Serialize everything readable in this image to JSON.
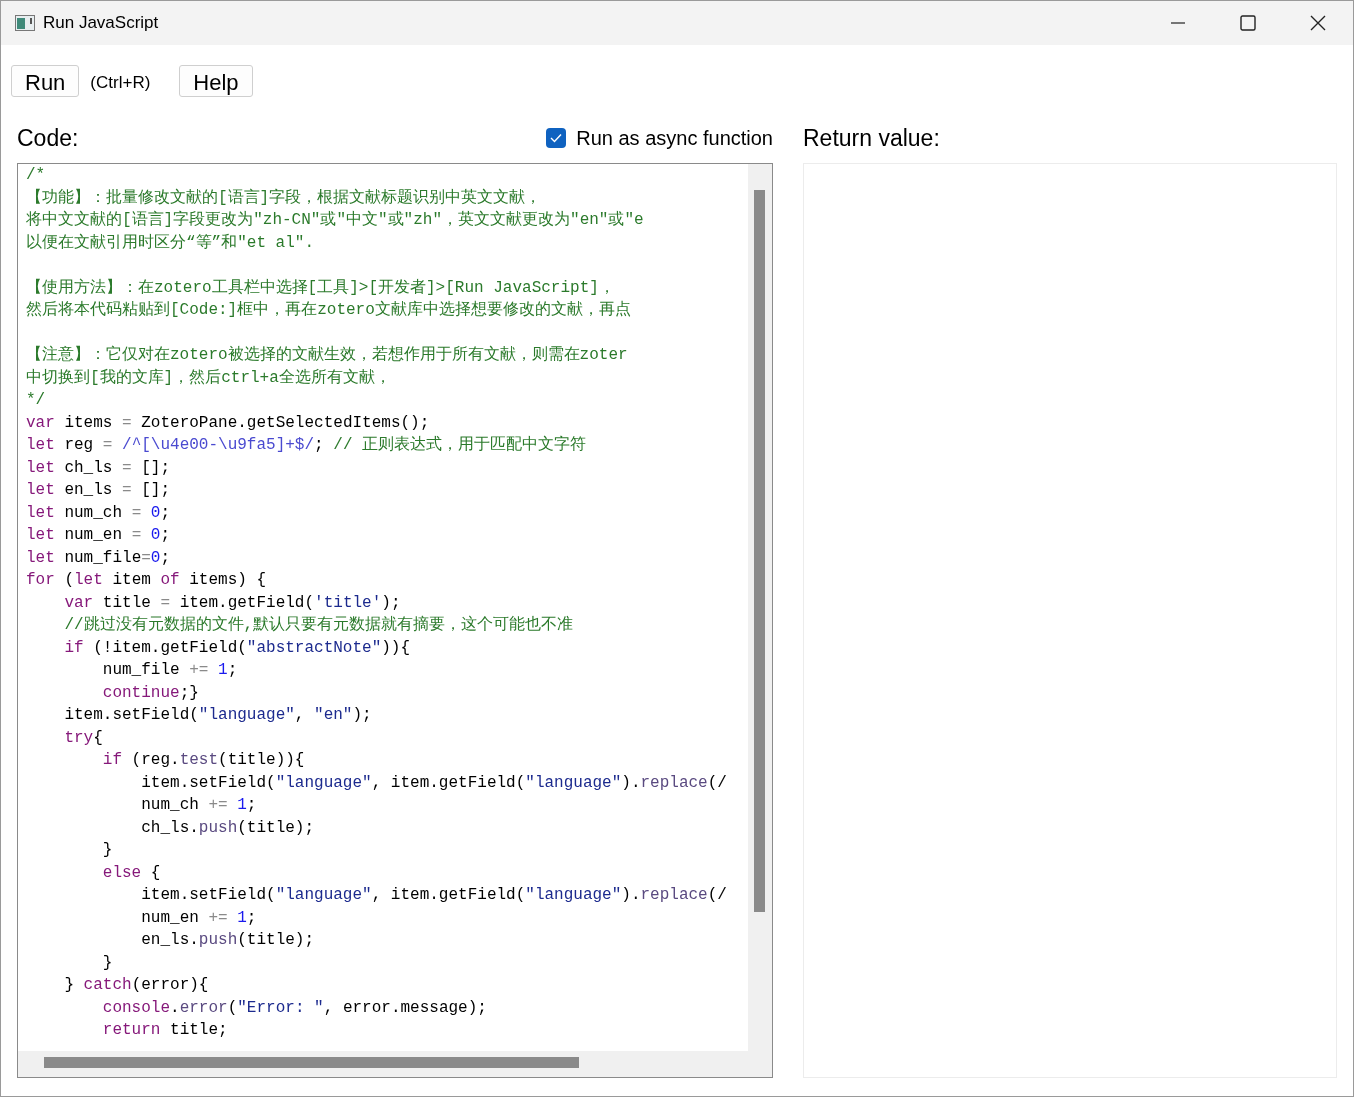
{
  "window": {
    "title": "Run JavaScript"
  },
  "toolbar": {
    "run_button": "Run",
    "shortcut": "(Ctrl+R)",
    "help_button": "Help"
  },
  "code_panel": {
    "label": "Code:",
    "async_option": {
      "label": "Run as async function",
      "checked": true
    },
    "lines": [
      {
        "tokens": [
          {
            "kind": "cmt",
            "text": "/*"
          }
        ]
      },
      {
        "tokens": [
          {
            "kind": "cmt",
            "text": "【功能】：批量修改文献的[语言]字段，根据文献标题识别中英文文献，"
          }
        ]
      },
      {
        "tokens": [
          {
            "kind": "cmt",
            "text": "将中文文献的[语言]字段更改为\"zh-CN\"或\"中文\"或\"zh\"，英文文献更改为\"en\"或\"e"
          }
        ]
      },
      {
        "tokens": [
          {
            "kind": "cmt",
            "text": "以便在文献引用时区分“等”和\"et al\"."
          }
        ]
      },
      {
        "kind": "blank"
      },
      {
        "tokens": [
          {
            "kind": "cmt",
            "text": "【使用方法】：在zotero工具栏中选择[工具]>[开发者]>[Run JavaScript]，"
          }
        ]
      },
      {
        "tokens": [
          {
            "kind": "cmt",
            "text": "然后将本代码粘贴到[Code:]框中，再在zotero文献库中选择想要修改的文献，再点"
          }
        ]
      },
      {
        "kind": "blank"
      },
      {
        "tokens": [
          {
            "kind": "cmt",
            "text": "【注意】：它仅对在zotero被选择的文献生效，若想作用于所有文献，则需在zoter"
          }
        ]
      },
      {
        "tokens": [
          {
            "kind": "cmt",
            "text": "中切换到[我的文库]，然后ctrl+a全选所有文献，"
          }
        ]
      },
      {
        "tokens": [
          {
            "kind": "cmt",
            "text": "*/"
          }
        ]
      },
      {
        "tokens": [
          {
            "kind": "kw",
            "text": "var"
          },
          {
            "kind": "tx",
            "text": " items "
          },
          {
            "kind": "op",
            "text": "="
          },
          {
            "kind": "tx",
            "text": " ZoteroPane.getSelectedItems();"
          }
        ]
      },
      {
        "tokens": [
          {
            "kind": "kw",
            "text": "let"
          },
          {
            "kind": "tx",
            "text": " reg "
          },
          {
            "kind": "op",
            "text": "="
          },
          {
            "kind": "re",
            "text": " /^[\\u4e00-\\u9fa5]+$/"
          },
          {
            "kind": "tx",
            "text": ";"
          },
          {
            "kind": "cmt",
            "text": " // 正则表达式，用于匹配中文字符"
          }
        ]
      },
      {
        "tokens": [
          {
            "kind": "kw",
            "text": "let"
          },
          {
            "kind": "tx",
            "text": " ch_ls "
          },
          {
            "kind": "op",
            "text": "="
          },
          {
            "kind": "tx",
            "text": " [];"
          }
        ]
      },
      {
        "tokens": [
          {
            "kind": "kw",
            "text": "let"
          },
          {
            "kind": "tx",
            "text": " en_ls "
          },
          {
            "kind": "op",
            "text": "="
          },
          {
            "kind": "tx",
            "text": " [];"
          }
        ]
      },
      {
        "tokens": [
          {
            "kind": "kw",
            "text": "let"
          },
          {
            "kind": "tx",
            "text": " num_ch "
          },
          {
            "kind": "op",
            "text": "="
          },
          {
            "kind": "num",
            "text": " 0"
          },
          {
            "kind": "tx",
            "text": ";"
          }
        ]
      },
      {
        "tokens": [
          {
            "kind": "kw",
            "text": "let"
          },
          {
            "kind": "tx",
            "text": " num_en "
          },
          {
            "kind": "op",
            "text": "="
          },
          {
            "kind": "num",
            "text": " 0"
          },
          {
            "kind": "tx",
            "text": ";"
          }
        ]
      },
      {
        "tokens": [
          {
            "kind": "kw",
            "text": "let"
          },
          {
            "kind": "tx",
            "text": " num_file"
          },
          {
            "kind": "op",
            "text": "="
          },
          {
            "kind": "num",
            "text": "0"
          },
          {
            "kind": "tx",
            "text": ";"
          }
        ]
      },
      {
        "tokens": [
          {
            "kind": "kw",
            "text": "for"
          },
          {
            "kind": "tx",
            "text": " ("
          },
          {
            "kind": "kw",
            "text": "let"
          },
          {
            "kind": "tx",
            "text": " item "
          },
          {
            "kind": "kw",
            "text": "of"
          },
          {
            "kind": "tx",
            "text": " items) {"
          }
        ]
      },
      {
        "tokens": [
          {
            "kind": "kw",
            "text": "    var"
          },
          {
            "kind": "tx",
            "text": " title "
          },
          {
            "kind": "op",
            "text": "="
          },
          {
            "kind": "tx",
            "text": " item.getField("
          },
          {
            "kind": "str",
            "text": "'title'"
          },
          {
            "kind": "tx",
            "text": ");"
          }
        ]
      },
      {
        "tokens": [
          {
            "kind": "cmt",
            "text": "    //跳过没有元数据的文件,默认只要有元数据就有摘要，这个可能也不准"
          }
        ]
      },
      {
        "tokens": [
          {
            "kind": "kw",
            "text": "    if"
          },
          {
            "kind": "tx",
            "text": " (!item.getField("
          },
          {
            "kind": "str",
            "text": "\"abstractNote\""
          },
          {
            "kind": "tx",
            "text": ")){"
          }
        ]
      },
      {
        "tokens": [
          {
            "kind": "tx",
            "text": "        num_file "
          },
          {
            "kind": "op",
            "text": "+="
          },
          {
            "kind": "num",
            "text": " 1"
          },
          {
            "kind": "tx",
            "text": ";"
          }
        ]
      },
      {
        "tokens": [
          {
            "kind": "kw",
            "text": "        continue"
          },
          {
            "kind": "tx",
            "text": ";}"
          }
        ]
      },
      {
        "tokens": [
          {
            "kind": "tx",
            "text": "    item.setField("
          },
          {
            "kind": "str",
            "text": "\"language\""
          },
          {
            "kind": "tx",
            "text": ", "
          },
          {
            "kind": "str",
            "text": "\"en\""
          },
          {
            "kind": "tx",
            "text": ");"
          }
        ]
      },
      {
        "tokens": [
          {
            "kind": "kw",
            "text": "    try"
          },
          {
            "kind": "tx",
            "text": "{"
          }
        ]
      },
      {
        "tokens": [
          {
            "kind": "kw",
            "text": "        if"
          },
          {
            "kind": "tx",
            "text": " (reg."
          },
          {
            "kind": "fn",
            "text": "test"
          },
          {
            "kind": "tx",
            "text": "(title)){"
          }
        ]
      },
      {
        "tokens": [
          {
            "kind": "tx",
            "text": "            item.setField("
          },
          {
            "kind": "str",
            "text": "\"language\""
          },
          {
            "kind": "tx",
            "text": ", item.getField("
          },
          {
            "kind": "str",
            "text": "\"language\""
          },
          {
            "kind": "tx",
            "text": ")."
          },
          {
            "kind": "fn",
            "text": "replace"
          },
          {
            "kind": "tx",
            "text": "(/"
          }
        ]
      },
      {
        "tokens": [
          {
            "kind": "tx",
            "text": "            num_ch "
          },
          {
            "kind": "op",
            "text": "+="
          },
          {
            "kind": "num",
            "text": " 1"
          },
          {
            "kind": "tx",
            "text": ";"
          }
        ]
      },
      {
        "tokens": [
          {
            "kind": "tx",
            "text": "            ch_ls."
          },
          {
            "kind": "fn",
            "text": "push"
          },
          {
            "kind": "tx",
            "text": "(title);"
          }
        ]
      },
      {
        "tokens": [
          {
            "kind": "tx",
            "text": "        }"
          }
        ]
      },
      {
        "tokens": [
          {
            "kind": "kw",
            "text": "        else"
          },
          {
            "kind": "tx",
            "text": " {"
          }
        ]
      },
      {
        "tokens": [
          {
            "kind": "tx",
            "text": "            item.setField("
          },
          {
            "kind": "str",
            "text": "\"language\""
          },
          {
            "kind": "tx",
            "text": ", item.getField("
          },
          {
            "kind": "str",
            "text": "\"language\""
          },
          {
            "kind": "tx",
            "text": ")."
          },
          {
            "kind": "fn",
            "text": "replace"
          },
          {
            "kind": "tx",
            "text": "(/"
          }
        ]
      },
      {
        "tokens": [
          {
            "kind": "tx",
            "text": "            num_en "
          },
          {
            "kind": "op",
            "text": "+="
          },
          {
            "kind": "num",
            "text": " 1"
          },
          {
            "kind": "tx",
            "text": ";"
          }
        ]
      },
      {
        "tokens": [
          {
            "kind": "tx",
            "text": "            en_ls."
          },
          {
            "kind": "fn",
            "text": "push"
          },
          {
            "kind": "tx",
            "text": "(title);"
          }
        ]
      },
      {
        "tokens": [
          {
            "kind": "tx",
            "text": "        }"
          }
        ]
      },
      {
        "tokens": [
          {
            "kind": "tx",
            "text": "    } "
          },
          {
            "kind": "kw",
            "text": "catch"
          },
          {
            "kind": "tx",
            "text": "(error){"
          }
        ]
      },
      {
        "tokens": [
          {
            "kind": "kw",
            "text": "        console"
          },
          {
            "kind": "tx",
            "text": "."
          },
          {
            "kind": "fn",
            "text": "error"
          },
          {
            "kind": "tx",
            "text": "("
          },
          {
            "kind": "str",
            "text": "\"Error: \""
          },
          {
            "kind": "tx",
            "text": ", error.message);"
          }
        ]
      },
      {
        "tokens": [
          {
            "kind": "kw",
            "text": "        return"
          },
          {
            "kind": "tx",
            "text": " title;"
          }
        ]
      }
    ]
  },
  "return_panel": {
    "label": "Return value:"
  }
}
